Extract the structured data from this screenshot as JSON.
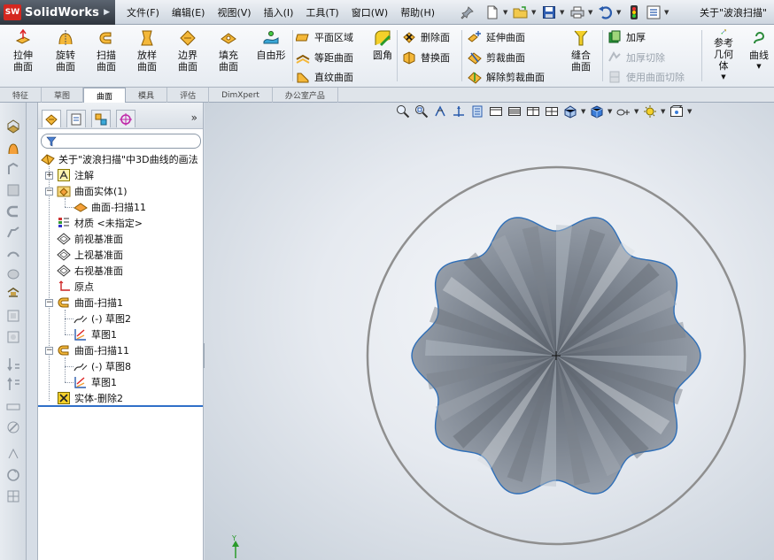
{
  "app": {
    "logo_text": "SolidWorks",
    "logo_badge": "SW"
  },
  "menu": [
    "文件(F)",
    "编辑(E)",
    "视图(V)",
    "插入(I)",
    "工具(T)",
    "窗口(W)",
    "帮助(H)"
  ],
  "document_title": "关于\"波浪扫描\"",
  "ribbon": {
    "big_buttons": [
      {
        "label": "拉伸曲面",
        "icon": "extruded-surface-icon"
      },
      {
        "label": "旋转曲面",
        "icon": "revolved-surface-icon"
      },
      {
        "label": "扫描曲面",
        "icon": "swept-surface-icon"
      },
      {
        "label": "放样曲面",
        "icon": "lofted-surface-icon"
      },
      {
        "label": "边界曲面",
        "icon": "boundary-surface-icon"
      },
      {
        "label": "填充曲面",
        "icon": "filled-surface-icon"
      },
      {
        "label": "自由形",
        "icon": "freeform-icon"
      }
    ],
    "col1": [
      "平面区域",
      "等距曲面",
      "直纹曲面"
    ],
    "fillet": "圆角",
    "col2": [
      "删除面",
      "替换面"
    ],
    "col3": [
      "延伸曲面",
      "剪裁曲面",
      "解除剪裁曲面"
    ],
    "knit": "缝合曲面",
    "col4": [
      "加厚",
      "加厚切除",
      "使用曲面切除"
    ],
    "reference_geometry": "参考几何体",
    "curves": "曲线"
  },
  "tabs": [
    "特征",
    "草图",
    "曲面",
    "模具",
    "评估",
    "DimXpert",
    "办公室产品"
  ],
  "active_tab": "曲面",
  "tree": {
    "root": "关于\"波浪扫描\"中3D曲线的画法",
    "annotations": "注解",
    "surface_bodies": "曲面实体(1)",
    "surface_sweep_child": "曲面-扫描11",
    "material": "材质 <未指定>",
    "front_plane": "前视基准面",
    "top_plane": "上视基准面",
    "right_plane": "右视基准面",
    "origin": "原点",
    "sweep1": "曲面-扫描1",
    "sweep1_sketch2": "(-) 草图2",
    "sweep1_sketch1": "草图1",
    "sweep11": "曲面-扫描11",
    "sweep11_sketch8": "(-) 草图8",
    "sweep11_sketch1": "草图1",
    "delete_body": "实体-删除2"
  },
  "triad": {
    "y_label": "Y"
  },
  "colors": {
    "accent": "#3070c8",
    "surface": "#8a919b",
    "edge": "#2f6fb8"
  }
}
